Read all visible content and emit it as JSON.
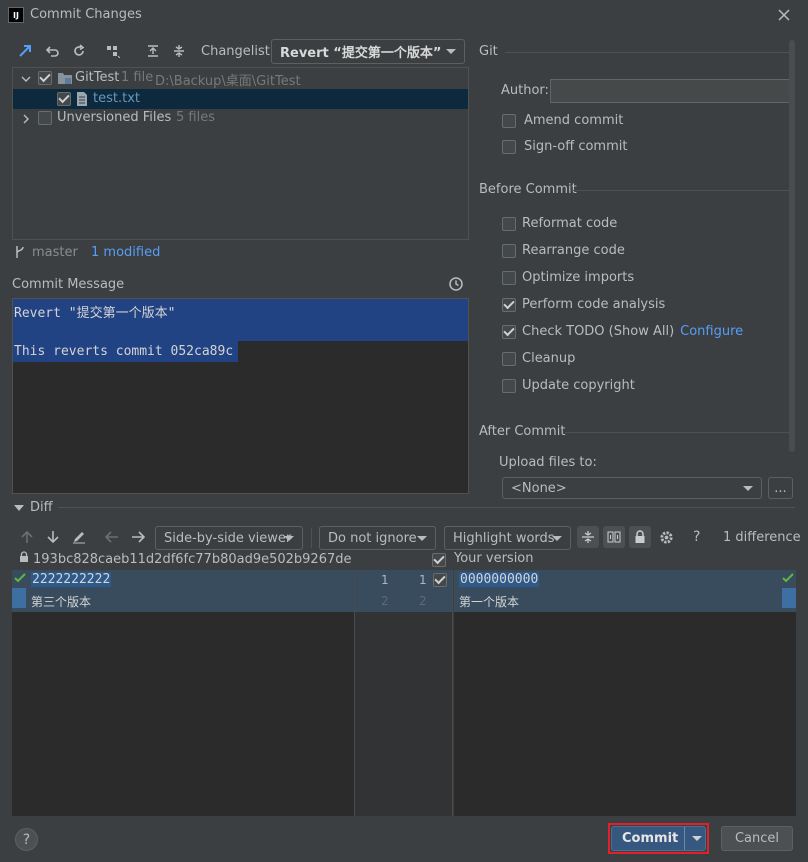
{
  "window": {
    "title": "Commit Changes",
    "app_badge": "IJ"
  },
  "toolbar": {
    "changelist_label": "Changelist:",
    "changelist_value": "Revert “提交第一个版本”"
  },
  "tree": {
    "root_label": "GitTest",
    "root_count": "1 file",
    "root_path": "D:\\Backup\\桌面\\GitTest",
    "file_label": "test.txt",
    "unversioned_label": "Unversioned Files",
    "unversioned_count": "5 files"
  },
  "status": {
    "branch": "master",
    "modified": "1 modified"
  },
  "commit_message": {
    "title": "Commit Message",
    "line1": "Revert \"提交第一个版本\"",
    "line2": "This reverts commit 052ca89c"
  },
  "git": {
    "section_title": "Git",
    "author_label": "Author:",
    "author_value": "",
    "amend": "Amend commit",
    "signoff": "Sign-off commit"
  },
  "before_commit": {
    "title": "Before Commit",
    "reformat": "Reformat code",
    "rearrange": "Rearrange code",
    "optimize": "Optimize imports",
    "analysis": "Perform code analysis",
    "todo": "Check TODO (Show All)",
    "configure": "Configure",
    "cleanup": "Cleanup",
    "copyright": "Update copyright"
  },
  "after_commit": {
    "title": "After Commit",
    "upload_label": "Upload files to:",
    "upload_value": "<None>",
    "browse": "..."
  },
  "diff": {
    "title": "Diff",
    "viewer": "Side-by-side viewer",
    "ignore": "Do not ignore",
    "highlight": "Highlight words",
    "count": "1 difference",
    "help": "?",
    "left_header": "193bc828caeb11d2df6fc77b80ad9e502b9267de",
    "right_header": "Your version",
    "left_line1": "2222222222",
    "left_line2": "第三个版本",
    "right_line1": "0000000000",
    "right_line2": "第一个版本",
    "gutter": [
      "1",
      "2"
    ]
  },
  "footer": {
    "commit": "Commit",
    "cancel": "Cancel",
    "help": "?"
  },
  "colors": {
    "bg": "#3c3f41",
    "editor": "#2b2b2b",
    "selection": "#214283",
    "link": "#589df6",
    "primary": "#365880",
    "highlight_border": "#e0202c"
  }
}
